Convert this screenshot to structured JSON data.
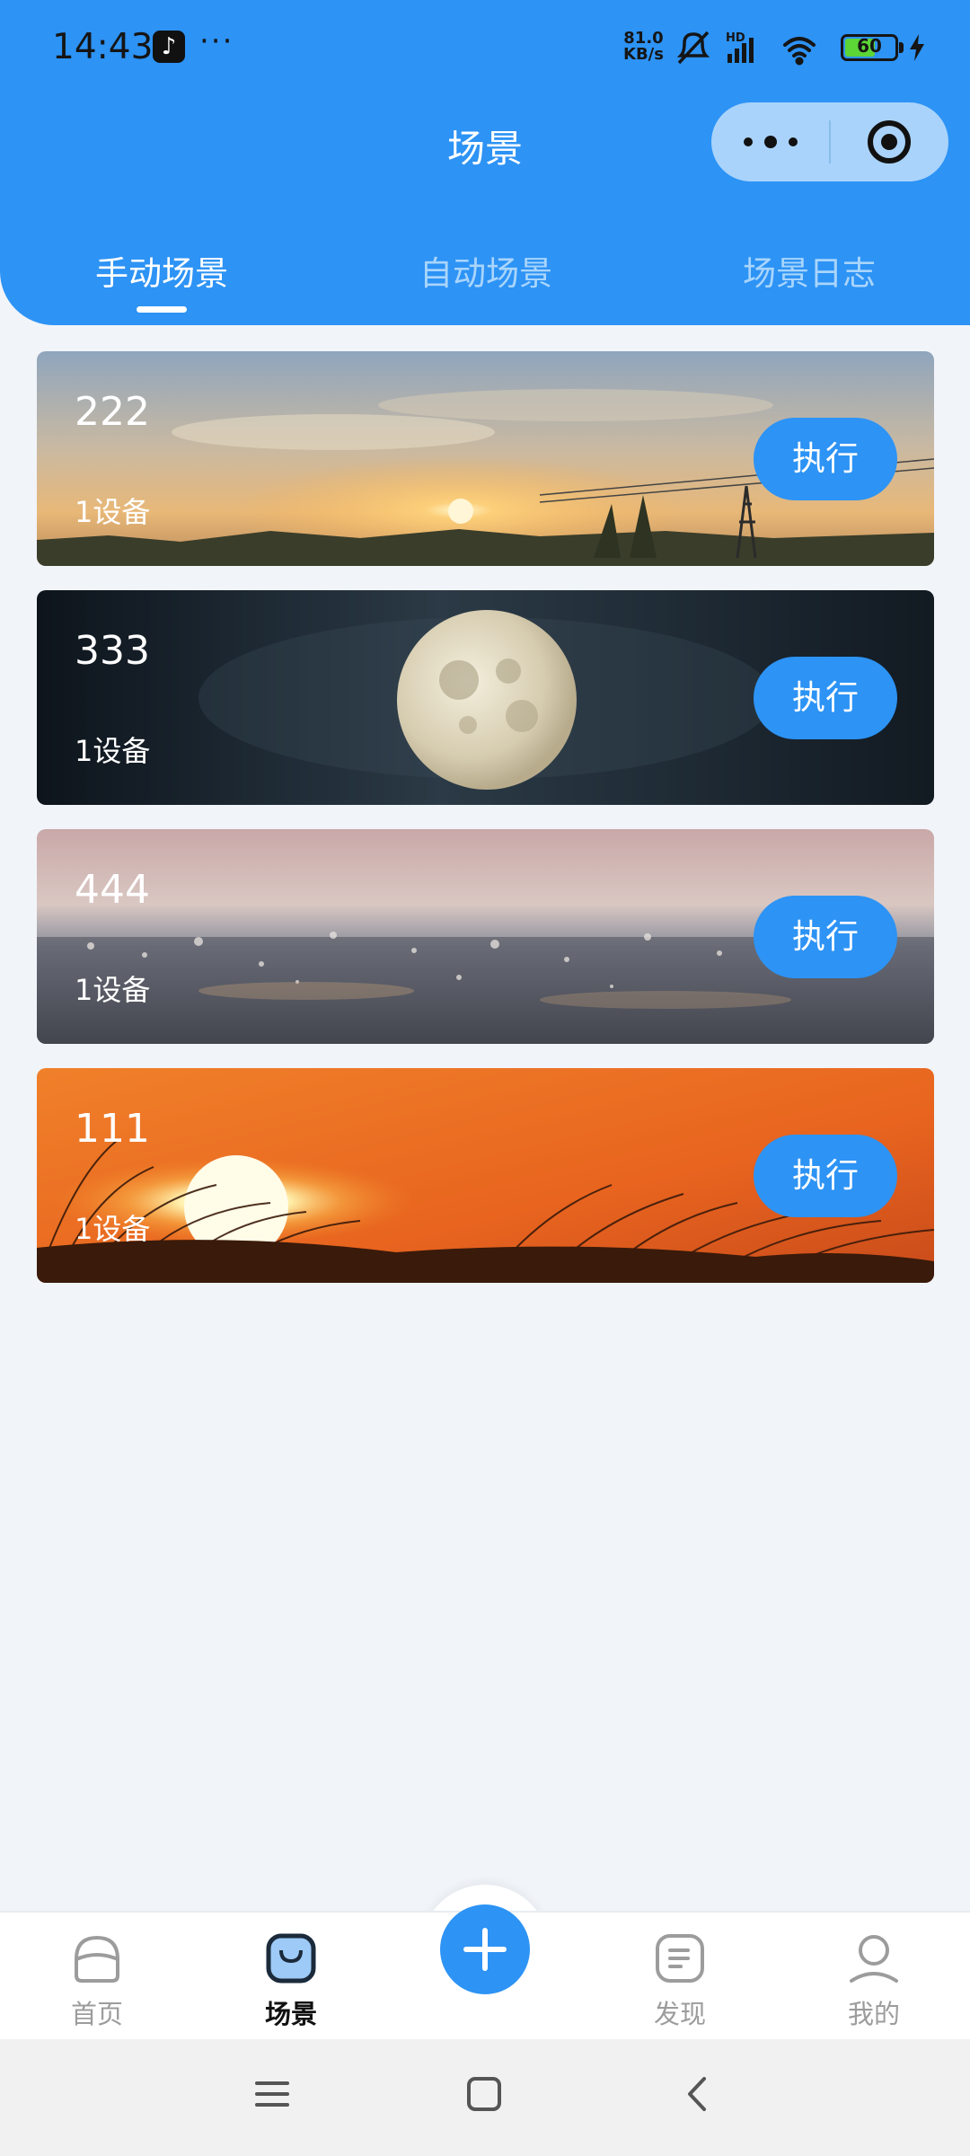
{
  "status_bar": {
    "time": "14:43",
    "more": "···",
    "net_speed_value": "81.0",
    "net_speed_unit": "KB/s",
    "battery": "60",
    "icons": [
      "tiktok-icon",
      "mute-icon",
      "hd-signal-icon",
      "wifi-icon",
      "battery-icon",
      "charging-icon"
    ]
  },
  "header": {
    "title": "场景",
    "capsule_icons": [
      "more-icon",
      "target-icon"
    ]
  },
  "tabs": [
    {
      "label": "手动场景",
      "active": true
    },
    {
      "label": "自动场景",
      "active": false
    },
    {
      "label": "场景日志",
      "active": false
    }
  ],
  "scenes": [
    {
      "name": "222",
      "devices": "1设备",
      "action": "执行",
      "image": "sunset-landscape"
    },
    {
      "name": "333",
      "devices": "1设备",
      "action": "执行",
      "image": "full-moon"
    },
    {
      "name": "444",
      "devices": "1设备",
      "action": "执行",
      "image": "rain-splash"
    },
    {
      "name": "111",
      "devices": "1设备",
      "action": "执行",
      "image": "orange-sunset-grass"
    }
  ],
  "tabbar": {
    "items": [
      {
        "label": "首页",
        "icon": "home-icon",
        "active": false
      },
      {
        "label": "场景",
        "icon": "scene-icon",
        "active": true
      },
      {
        "label": "发现",
        "icon": "discover-icon",
        "active": false
      },
      {
        "label": "我的",
        "icon": "profile-icon",
        "active": false
      }
    ],
    "add_icon": "plus-icon"
  },
  "colors": {
    "primary": "#2d93f5",
    "background": "#f1f4f9",
    "tab_inactive": "#a9d5fc"
  }
}
